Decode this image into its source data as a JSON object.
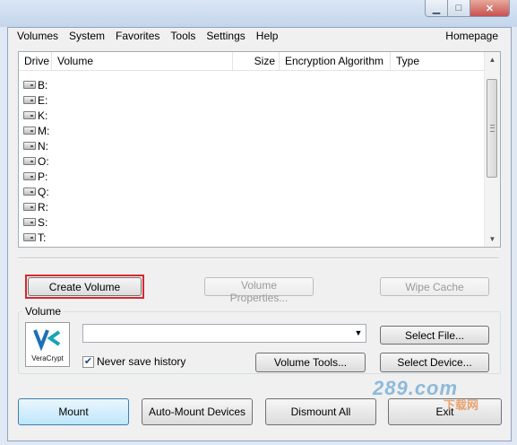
{
  "window": {
    "minimize_glyph": "▁",
    "maximize_glyph": "□",
    "close_glyph": "✕"
  },
  "menu": {
    "items": [
      "Volumes",
      "System",
      "Favorites",
      "Tools",
      "Settings",
      "Help"
    ],
    "homepage": "Homepage"
  },
  "drive_list": {
    "columns": [
      "Drive",
      "Volume",
      "Size",
      "Encryption Algorithm",
      "Type"
    ],
    "drives": [
      "B:",
      "E:",
      "K:",
      "M:",
      "N:",
      "O:",
      "P:",
      "Q:",
      "R:",
      "S:",
      "T:"
    ]
  },
  "buttons": {
    "create_volume": "Create Volume",
    "volume_properties": "Volume Properties...",
    "wipe_cache": "Wipe Cache",
    "select_file": "Select File...",
    "volume_tools": "Volume Tools...",
    "select_device": "Select Device...",
    "mount": "Mount",
    "auto_mount": "Auto-Mount Devices",
    "dismount_all": "Dismount All",
    "exit": "Exit"
  },
  "volume": {
    "label": "Volume",
    "path_value": "",
    "never_save_history": "Never save history",
    "never_save_history_checked": true,
    "logo_text": "VeraCrypt"
  },
  "colors": {
    "highlight_border": "#d9262f",
    "logo_blue": "#1d6fb8",
    "logo_teal": "#18a3b8"
  },
  "watermark": {
    "main": "289.com",
    "sub": "下载网"
  }
}
